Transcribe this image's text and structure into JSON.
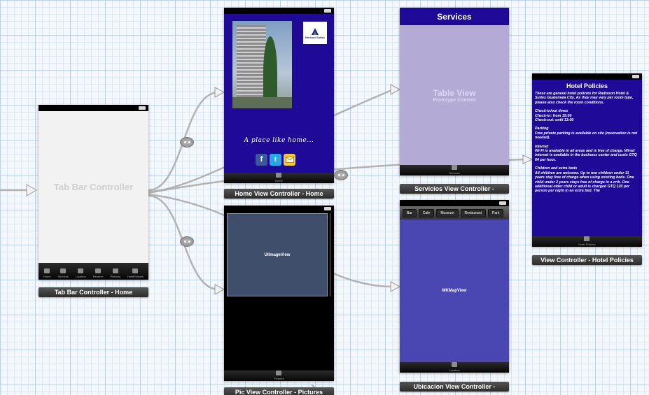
{
  "tab_bar_controller": {
    "title": "Tab Bar Controller",
    "tabs": [
      "Home",
      "Services",
      "Location",
      "Reserve",
      "Pictures",
      "HotelPolicies"
    ],
    "label": "Tab Bar Controller - Home"
  },
  "home": {
    "logo_text": "Horizon Suites",
    "tagline": "A place like home...",
    "tab": "Home",
    "label": "Home View Controller - Home"
  },
  "pictures": {
    "image_view": "UIImageView",
    "tab": "Pictures",
    "label": "Pic View Controller - Pictures"
  },
  "services": {
    "nav_title": "Services",
    "table_title": "Table View",
    "table_subtitle": "Prototype Content",
    "tab": "Services",
    "label": "Servicios View Controller -"
  },
  "location": {
    "segments": [
      "Bar",
      "Cafe",
      "Museum",
      "Restaurant",
      "Park"
    ],
    "map_view": "MKMapView",
    "tab": "Location",
    "label": "Ubicacion View Controller -"
  },
  "policies": {
    "title": "Hotel Policies",
    "paragraphs": [
      "These are general hotel policies for Radisson Hotel & Suites Guatemala City. As they may vary per room type, please also check the room conditions.",
      "Check-in/out times\nCheck-in: from 15:00\nCheck-out: until 13:00",
      "Parking\nFree private parking is available on site (reservation is not needed).",
      "Internet\nWi-Fi is available in all areas and is free of charge. Wired internet is available in the business center and costs GTQ 64 per hour.",
      "Children and extra beds\nAll children are welcome. Up to two children under 11 years stay free of charge when using existing beds. One child under 2 years stays free of charge in a crib. One additional older child or adult is charged GTQ 120 per person per night in an extra bed. The"
    ],
    "tab": "Hotel Policies",
    "label": "View Controller - Hotel Policies"
  },
  "colors": {
    "indigo": "#1e0a96",
    "lavender": "#b3abd6",
    "map_blue": "#4a46b2",
    "image_slate": "#3f4e6b",
    "segue_gray": "#b3b3b3"
  }
}
